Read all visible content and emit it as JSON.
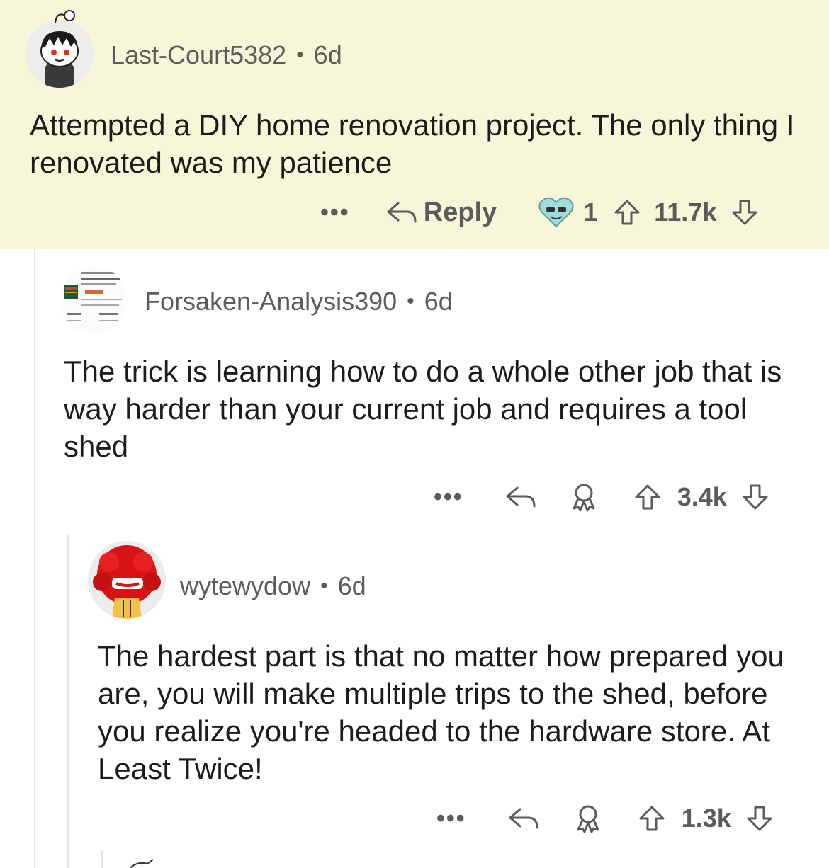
{
  "comments": [
    {
      "username": "Last-Court5382",
      "age": "6d",
      "body": "Attempted a DIY home renovation project. The only thing I renovated was my patience",
      "reply_label": "Reply",
      "award_count": "1",
      "votes": "11.7k"
    },
    {
      "username": "Forsaken-Analysis390",
      "age": "6d",
      "body": "The trick is learning how to do a whole other job that is way harder than your current job and requires a tool shed",
      "votes": "3.4k"
    },
    {
      "username": "wytewydow",
      "age": "6d",
      "body": "The hardest part is that no matter how prepared you are, you will make multiple trips to the shed, before you realize you're headed to the hardware store. At Least Twice!",
      "votes": "1.3k"
    }
  ],
  "colors": {
    "highlight_bg": "#f8f6d8",
    "meta_text": "#5b5b5b",
    "thread_line": "#e4e4e4"
  },
  "icons": [
    "more-icon",
    "reply-icon",
    "award-icon",
    "upvote-icon",
    "downvote-icon"
  ]
}
